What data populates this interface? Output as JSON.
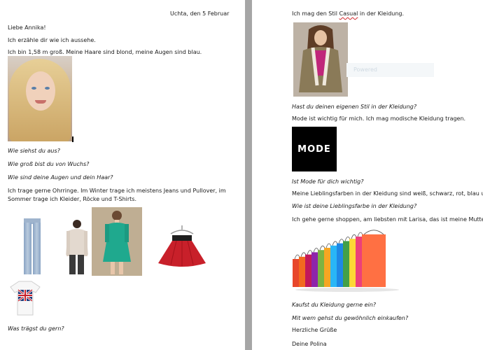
{
  "left_page": {
    "date_line": "Uchta, den 5 Februar",
    "greeting": "Liebe Annika!",
    "intro": "Ich erzähle dir wie ich aussehe.",
    "description": "Ich bin 1,58 m groß. Meine Haare sind blond, meine Augen sind blau.",
    "q1": "Wie siehst du aus?",
    "q2": "Wie groß bist du von Wuchs?",
    "q3": "Wie sind deine Augen und dein Haar?",
    "clothes_line1": "Ich trage gerne Ohrringe. Im Winter trage ich meistens Jeans und Pullover, im",
    "clothes_line2": "Sommer trage ich Kleider, Röcke und T-Shirts.",
    "q4": "Was trägst du gern?"
  },
  "right_page": {
    "style_before": "Ich mag den Stil ",
    "style_word": "Casual",
    "style_after": " in der Kleidung.",
    "overlay_text": "Powered",
    "q5": "Hast du deinen eigenen  Stil in der Kleidung?",
    "mode_sentence": "Mode ist wichtig für mich. Ich mag  modische Kleidung tragen.",
    "mode_logo_text": "MODE",
    "q6": "Ist Mode für dich wichtig?",
    "colors_sentence": "Meine Lieblingsfarben in der Kleidung sind weiß, schwarz, rot, blau und and",
    "q7": "Wie ist deine Lieblingsfarbe in der Kleidung?",
    "shopping_sentence": "Ich gehe gerne shoppen, am liebsten mit Larisa, das ist meine Mutter.",
    "q8": "Kaufst du Kleidung gerne ein?",
    "q9": "Mit wem gehst du gewöhnlich einkaufen?",
    "closing": "Herzliche Grüße",
    "signature": "Deine Polina"
  }
}
